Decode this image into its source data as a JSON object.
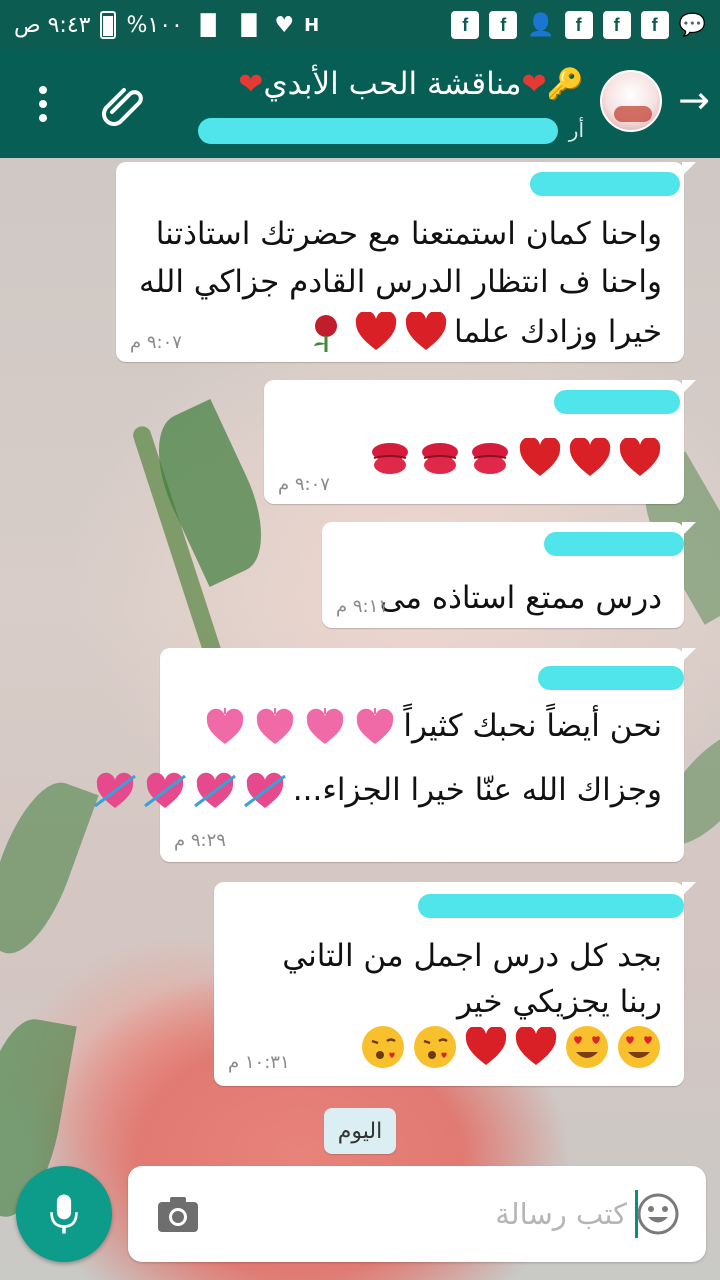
{
  "status_bar": {
    "time": "٩:٤٣ ص",
    "battery": "%١٠٠",
    "network": "H"
  },
  "header": {
    "title": "مناقشة الحب الأبدي",
    "subtitle_prefix": "أر",
    "back_icon": "arrow-icon",
    "attach_icon": "paperclip-icon",
    "menu_icon": "more-vert-icon"
  },
  "messages": [
    {
      "lines": [
        "واحنا كمان استمتعنا مع حضرتك استاذتنا",
        "واحنا ف انتظار الدرس القادم جزاكي الله",
        "خيرا وزادك علما"
      ],
      "emojis": [
        "red-heart",
        "red-heart",
        "rose"
      ],
      "time": "٩:٠٧ م"
    },
    {
      "lines": [],
      "emojis": [
        "red-heart",
        "red-heart",
        "red-heart",
        "kiss-mark",
        "kiss-mark",
        "kiss-mark"
      ],
      "time": "٩:٠٧ م"
    },
    {
      "lines": [
        "درس ممتع استاذه مى"
      ],
      "emojis": [],
      "time": "٩:١١ م"
    },
    {
      "lines": [
        "نحن أيضاً نحبك كثيراً",
        "وجزاك الله عنّا خيرا الجزاء..."
      ],
      "emojis": [
        "growing-heart",
        "growing-heart",
        "growing-heart",
        "growing-heart",
        "heart-with-arrow",
        "heart-with-arrow",
        "heart-with-arrow",
        "heart-with-arrow"
      ],
      "time": "٩:٢٩ م"
    },
    {
      "lines": [
        "بجد كل درس اجمل من التاني",
        "ربنا يجزيكي خير"
      ],
      "emojis": [
        "heart-eyes",
        "heart-eyes",
        "red-heart",
        "red-heart",
        "kissing-face",
        "kissing-face"
      ],
      "time": "١٠:٣١ م"
    }
  ],
  "date_chip": "اليوم",
  "composer": {
    "placeholder": "كتب رسالة",
    "value": "",
    "camera_icon": "camera-icon",
    "emoji_icon": "smiley-icon",
    "mic_icon": "microphone-icon"
  },
  "colors": {
    "header": "#075e54",
    "status_bar": "#0d5c52",
    "accent": "#0d9b8a",
    "bubble": "#ffffff",
    "redaction": "#4fe5ea"
  }
}
